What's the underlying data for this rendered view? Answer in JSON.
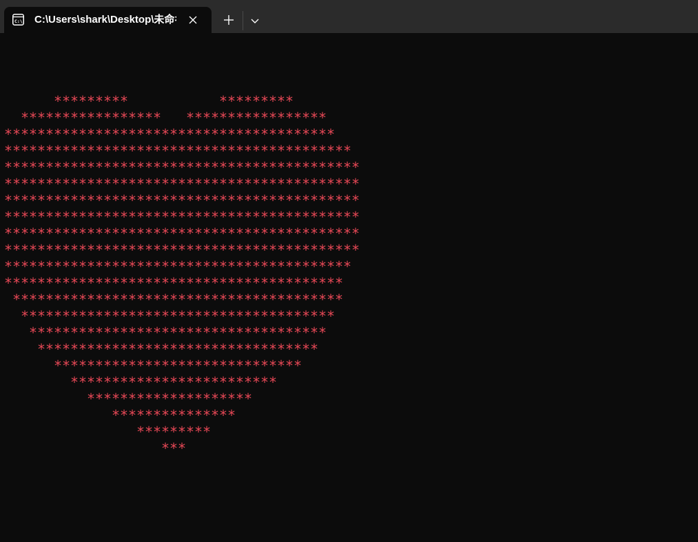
{
  "window": {
    "tab_title": "C:\\Users\\shark\\Desktop\\未命名",
    "tab_icon": "terminal-icon",
    "close_icon": "close-icon",
    "new_tab_icon": "plus-icon",
    "dropdown_icon": "chevron-down-icon"
  },
  "terminal": {
    "text_color": "#e74856",
    "background": "#0c0c0c",
    "lines": [
      "      *********           *********",
      "  *****************   *****************",
      "****************************************",
      "******************************************",
      "*******************************************",
      "*******************************************",
      "*******************************************",
      "*******************************************",
      "*******************************************",
      "*******************************************",
      "******************************************",
      "*****************************************",
      " ****************************************",
      "  **************************************",
      "   ************************************",
      "    **********************************",
      "      ******************************",
      "        *************************",
      "          ********************",
      "             ***************",
      "                *********",
      "                   ***"
    ]
  }
}
